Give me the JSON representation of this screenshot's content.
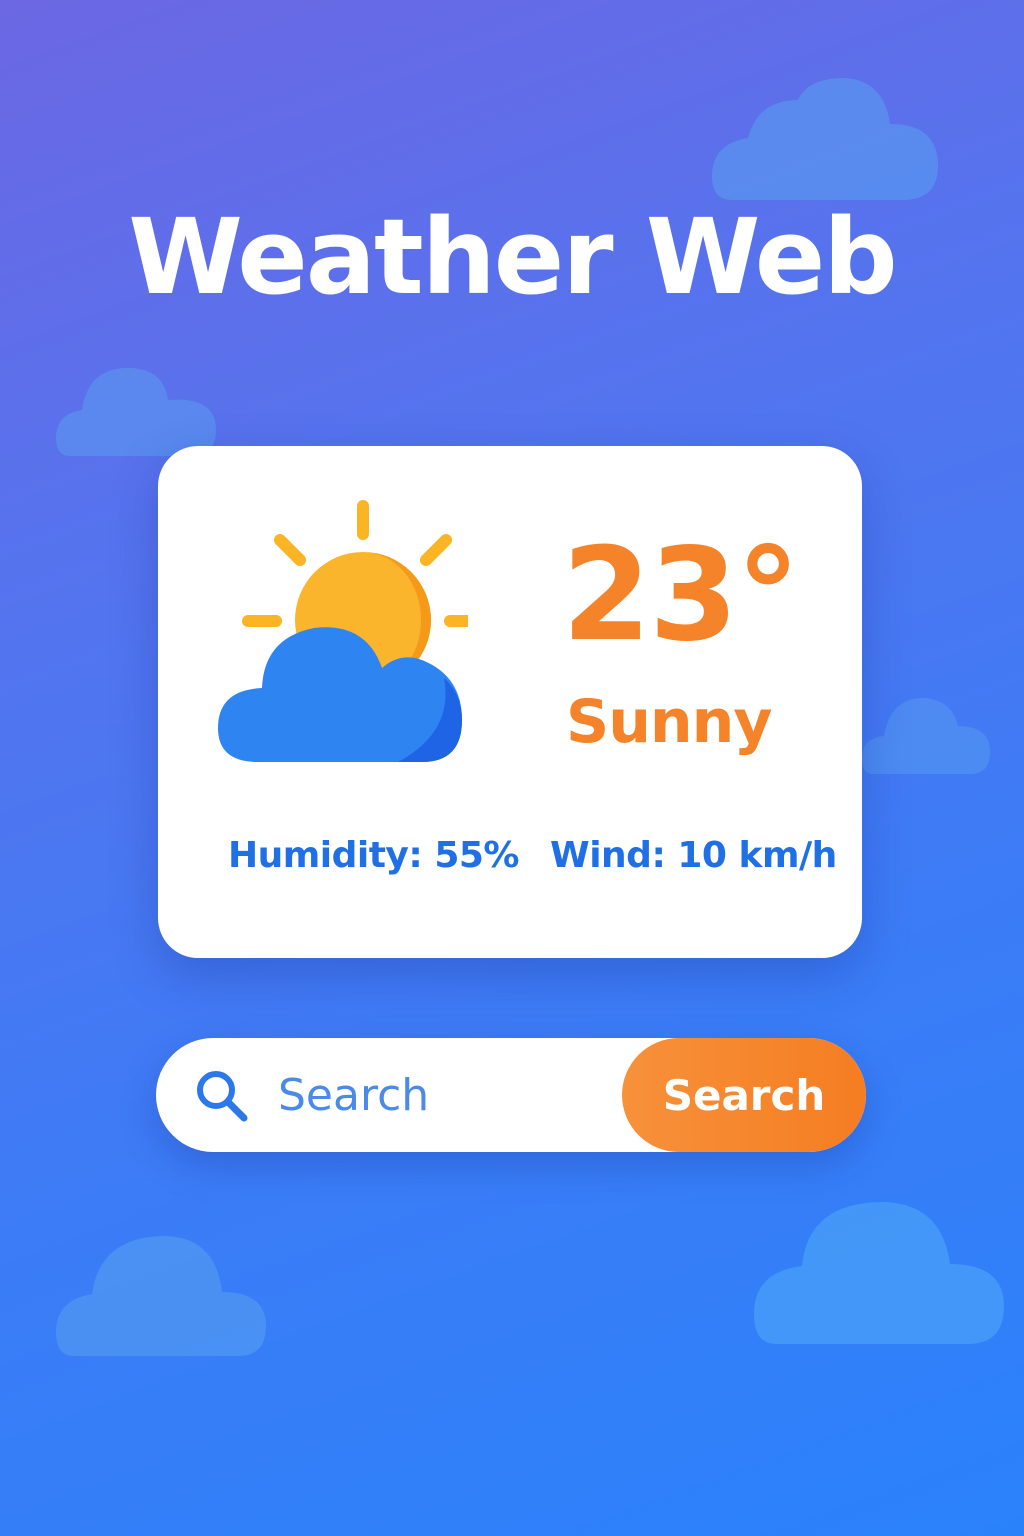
{
  "app": {
    "title": "Weather Web"
  },
  "weather": {
    "temperature": "23°",
    "condition": "Sunny",
    "humidity": "Humidity: 55%",
    "wind": "Wind: 10 km/h",
    "icon": "partly-sunny-icon"
  },
  "search": {
    "placeholder": "Search",
    "value": "",
    "button_label": "Search",
    "icon": "search-icon"
  },
  "colors": {
    "accent_orange": "#f5832a",
    "primary_blue": "#1f6fe6",
    "background_top": "#6c67e3",
    "background_bottom": "#2a82fb",
    "card": "#ffffff"
  }
}
